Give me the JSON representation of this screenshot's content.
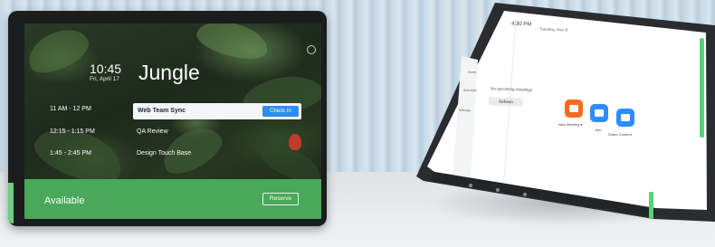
{
  "left_display": {
    "current_time": "10:45",
    "current_date": "Fri, April 17",
    "room_name": "Jungle",
    "meetings": [
      {
        "time": "11 AM - 12 PM",
        "title": "Web Team Sync",
        "action": "Check In",
        "highlighted": true
      },
      {
        "time": "12:15 - 1:15 PM",
        "title": "QA Review",
        "highlighted": false
      },
      {
        "time": "1:45 - 2:45 PM",
        "title": "Design Touch Base",
        "highlighted": false
      }
    ],
    "status": "Available",
    "reserve_label": "Reserve",
    "colors": {
      "available_green": "#4aa85a",
      "check_in_blue": "#2d8cf0",
      "led_green": "#6ccf82"
    }
  },
  "right_display": {
    "time": "4:30 PM",
    "date": "Tuesday, Nov 8",
    "nav_items": [
      "Home",
      "Schedule",
      "Settings"
    ],
    "empty_message": "No upcoming meetings",
    "refresh_label": "Refresh",
    "tiles": [
      {
        "label": "New Meeting ▾",
        "color": "#f26d21",
        "icon": "video-camera-icon"
      },
      {
        "label": "Join",
        "color": "#2d8cff",
        "icon": "plus-icon"
      },
      {
        "label": "Share Content",
        "color": "#2d8cff",
        "icon": "share-screen-icon"
      }
    ],
    "colors": {
      "led_green": "#57d37b"
    }
  }
}
